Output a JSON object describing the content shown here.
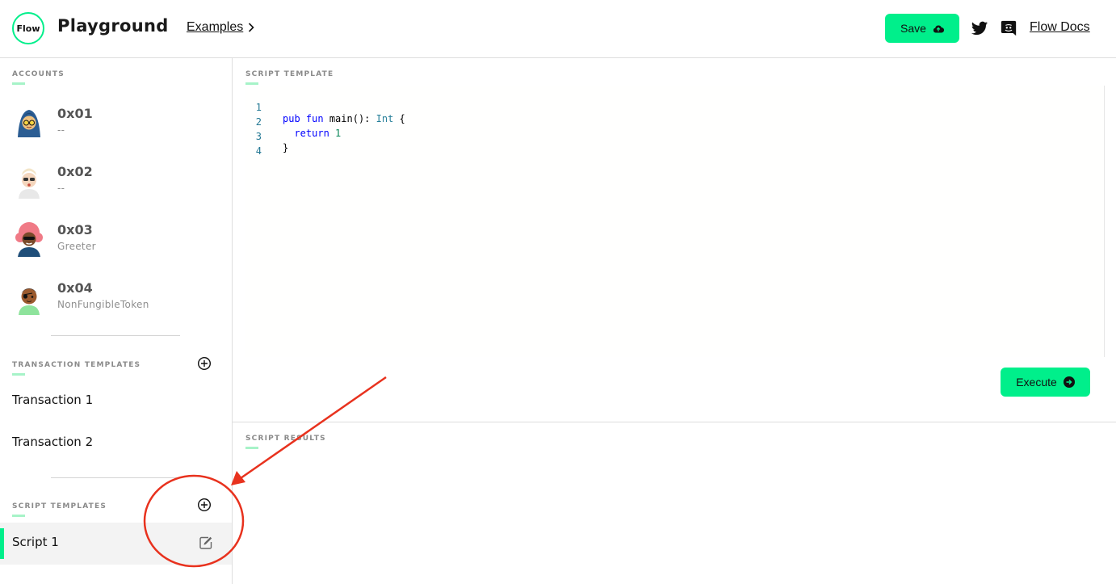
{
  "header": {
    "logo_text": "Flow",
    "title": "Playground",
    "examples_label": "Examples",
    "save_label": "Save",
    "docs_label": "Flow Docs"
  },
  "sidebar": {
    "accounts_label": "ACCOUNTS",
    "accounts": [
      {
        "address": "0x01",
        "contract": "--"
      },
      {
        "address": "0x02",
        "contract": "--"
      },
      {
        "address": "0x03",
        "contract": "Greeter"
      },
      {
        "address": "0x04",
        "contract": "NonFungibleToken"
      }
    ],
    "transaction_templates_label": "TRANSACTION TEMPLATES",
    "transactions": [
      {
        "label": "Transaction 1"
      },
      {
        "label": "Transaction 2"
      }
    ],
    "script_templates_label": "SCRIPT TEMPLATES",
    "scripts": [
      {
        "label": "Script 1",
        "active": true
      }
    ]
  },
  "editor": {
    "label": "SCRIPT TEMPLATE",
    "line_numbers": [
      "1",
      "2",
      "3",
      "4"
    ],
    "execute_label": "Execute"
  },
  "results": {
    "label": "SCRIPT RESULTS"
  },
  "colors": {
    "accent": "#00ef8b",
    "accent_light": "#a7f3c8",
    "annotation": "#e8321e"
  },
  "icons": [
    "flow-logo",
    "chevron-right-icon",
    "cloud-upload-icon",
    "twitter-icon",
    "discord-icon",
    "add-circle-icon",
    "edit-icon",
    "arrow-right-circle-icon"
  ]
}
